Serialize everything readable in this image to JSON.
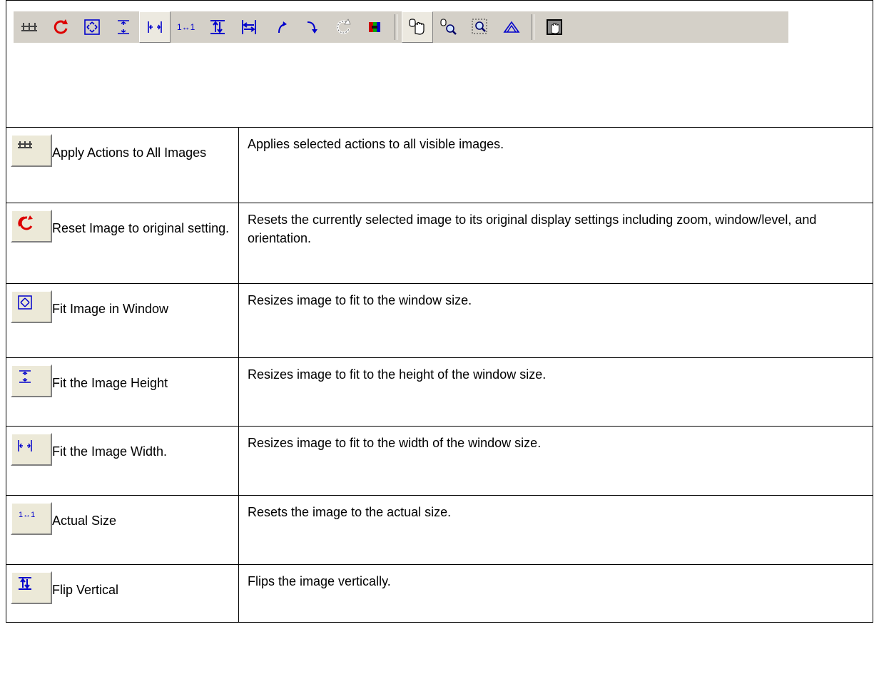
{
  "toolbar": {
    "buttons": [
      {
        "icon": "apply-all-icon"
      },
      {
        "icon": "reset-icon"
      },
      {
        "icon": "fit-window-icon"
      },
      {
        "icon": "fit-height-icon"
      },
      {
        "icon": "fit-width-icon",
        "pressed": true
      },
      {
        "icon": "actual-size-icon"
      },
      {
        "icon": "flip-vertical-icon"
      },
      {
        "icon": "flip-horizontal-icon"
      },
      {
        "icon": "rotate-left-icon"
      },
      {
        "icon": "rotate-right-icon"
      },
      {
        "icon": "rotate-icon"
      },
      {
        "icon": "color-icon"
      },
      {
        "icon": "pan-hand-icon",
        "pressed": true
      },
      {
        "icon": "zoom-icon"
      },
      {
        "icon": "zoom-region-icon"
      },
      {
        "icon": "home-icon"
      },
      {
        "icon": "hand-window-icon"
      }
    ]
  },
  "rows": [
    {
      "icon": "apply-all-icon",
      "name": "Apply Actions to All Images",
      "description": "Applies selected actions to all visible images."
    },
    {
      "icon": "reset-icon",
      "name": "Reset Image to original setting.",
      "description": " Resets the currently selected image to its original display settings including zoom, window/level, and orientation."
    },
    {
      "icon": "fit-window-icon",
      "name": "Fit Image in Window",
      "description": "Resizes image to fit to the window size."
    },
    {
      "icon": "fit-height-icon",
      "name": "Fit the Image Height",
      "description": "Resizes image to fit to the height of the window size."
    },
    {
      "icon": "fit-width-icon",
      "name": "Fit the Image Width.",
      "description": "Resizes image to fit to the width of the window size."
    },
    {
      "icon": "actual-size-icon",
      "name": "Actual Size",
      "description": "Resets the image to the actual size."
    },
    {
      "icon": "flip-vertical-icon",
      "name": "Flip Vertical",
      "description": "Flips the image vertically."
    }
  ],
  "colors": {
    "toolbar_bg": "#d4d0c8",
    "icon_blue": "#0000cc",
    "icon_red": "#dd0000"
  }
}
